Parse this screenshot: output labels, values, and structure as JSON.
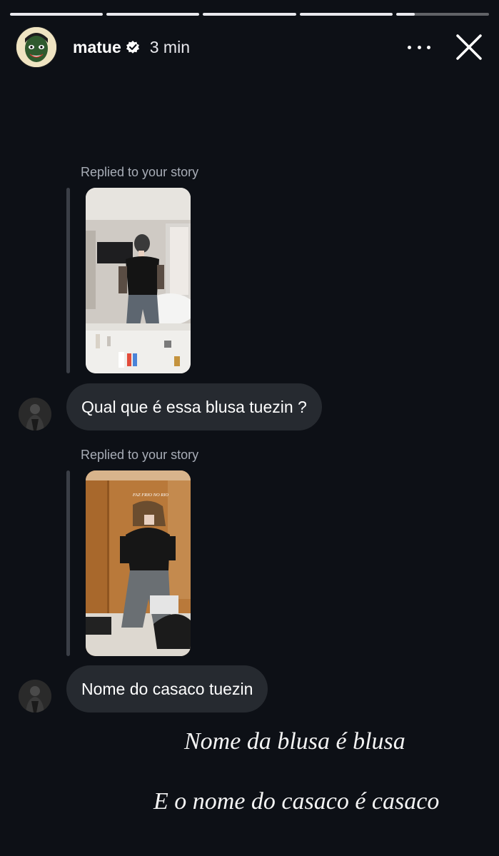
{
  "progress": {
    "segments": [
      1,
      1,
      1,
      1,
      0.2
    ]
  },
  "header": {
    "username": "matue",
    "time": "3 min",
    "verified_icon": "verified-badge-icon",
    "more_icon": "more-horizontal-icon",
    "close_icon": "close-icon"
  },
  "messages": [
    {
      "reply_label": "Replied to your story",
      "text": "Qual que é essa blusa tuezin ?"
    },
    {
      "reply_label": "Replied to your story",
      "story_overlay_text": "FAZ FRIO NO RIO",
      "text": "Nome do casaco tuezin"
    }
  ],
  "captions": {
    "line1": "Nome da blusa é blusa",
    "line2": "E o nome do casaco é casaco"
  },
  "colors": {
    "background": "#0d1016",
    "bubble": "#262a30",
    "reply_label": "#a8adb7"
  }
}
